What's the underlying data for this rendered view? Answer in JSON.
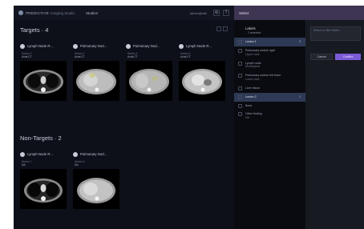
{
  "topbar": {
    "logo": "PREDICTIVE",
    "logo_sub": "Imaging Studio",
    "nav_link": "Studies",
    "user": "admin@site",
    "btn1": "⚙",
    "btn2": "?"
  },
  "targets": {
    "title": "Targets · 4",
    "cards": [
      {
        "title": "Lymph Node R…",
        "meta": "Series 3",
        "meta2": "Axial CT"
      },
      {
        "title": "Pulmonary Nod…",
        "meta": "Series 2",
        "meta2": "Axial CT"
      },
      {
        "title": "Pulmonary Nod…",
        "meta": "Series 4",
        "meta2": "Axial CT"
      },
      {
        "title": "Lymph Node R…",
        "meta": "Series 5",
        "meta2": "Axial CT"
      }
    ]
  },
  "non_targets": {
    "title": "Non-Targets · 2",
    "cards": [
      {
        "title": "Lymph Node R…",
        "meta": "Series 1",
        "meta2": "NA"
      },
      {
        "title": "Pulmonary Nod…",
        "meta": "Series 2",
        "meta2": "NA"
      }
    ]
  },
  "drawer": {
    "title": "Select",
    "list_title": "Labels",
    "list_sub": "2 selected",
    "items": [
      {
        "label": "Lesion 1",
        "sub": "",
        "count": "2",
        "selected": true
      },
      {
        "label": "Pulmonary nodule right",
        "sub": "Upper lobe",
        "count": "",
        "selected": false
      },
      {
        "label": "Lymph node",
        "sub": "Mediastinal",
        "count": "",
        "selected": false
      },
      {
        "label": "Pulmonary nodule left lower",
        "sub": "Lower lobe",
        "count": "",
        "selected": false
      },
      {
        "label": "Liver lesion",
        "sub": "",
        "count": "",
        "selected": false
      },
      {
        "label": "Lesion 2",
        "sub": "",
        "count": "1",
        "selected": true
      },
      {
        "label": "Bone",
        "sub": "",
        "count": "",
        "selected": false
      },
      {
        "label": "Other finding",
        "sub": "NA",
        "count": "",
        "selected": false
      }
    ],
    "search_placeholder": "Search or filter labels…",
    "cancel_label": "Cancel",
    "apply_label": "Confirm"
  },
  "colors": {
    "accent": "#7b5bd6",
    "drawer_header": "#3d3551",
    "selected_row": "#2e3a55"
  }
}
